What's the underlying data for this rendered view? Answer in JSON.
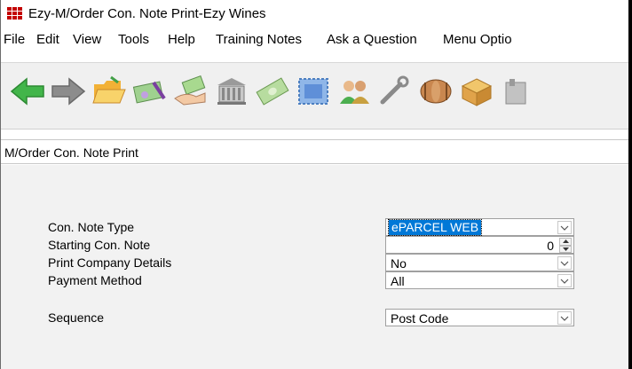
{
  "window": {
    "title": "Ezy-M/Order Con. Note Print-Ezy Wines"
  },
  "menu": {
    "items": [
      "File",
      "Edit",
      "View",
      "Tools",
      "Help",
      "Training Notes",
      "Ask a Question",
      "Menu Optio"
    ]
  },
  "toolbar": {
    "buttons": [
      "back-arrow-icon",
      "forward-arrow-icon",
      "folder-open-icon",
      "cheque-icon",
      "hand-money-icon",
      "bank-icon",
      "money-notes-icon",
      "stamp-icon",
      "people-icon",
      "wrench-icon",
      "barrel-icon",
      "box-icon",
      "more-icon"
    ]
  },
  "panel": {
    "title": "M/Order Con. Note Print"
  },
  "form": {
    "con_note_type": {
      "label": "Con. Note Type",
      "value": "ePARCEL WEB"
    },
    "starting_con_note": {
      "label": "Starting Con. Note",
      "value": "0"
    },
    "print_company_details": {
      "label": "Print Company Details",
      "value": "No"
    },
    "payment_method": {
      "label": "Payment Method",
      "value": "All"
    },
    "sequence": {
      "label": "Sequence",
      "value": "Post Code"
    }
  },
  "colors": {
    "selection": "#0078d7",
    "app_icon": "#c40000",
    "toolbar_bg": "#f0f0f0",
    "form_bg": "#f2f2f2"
  }
}
